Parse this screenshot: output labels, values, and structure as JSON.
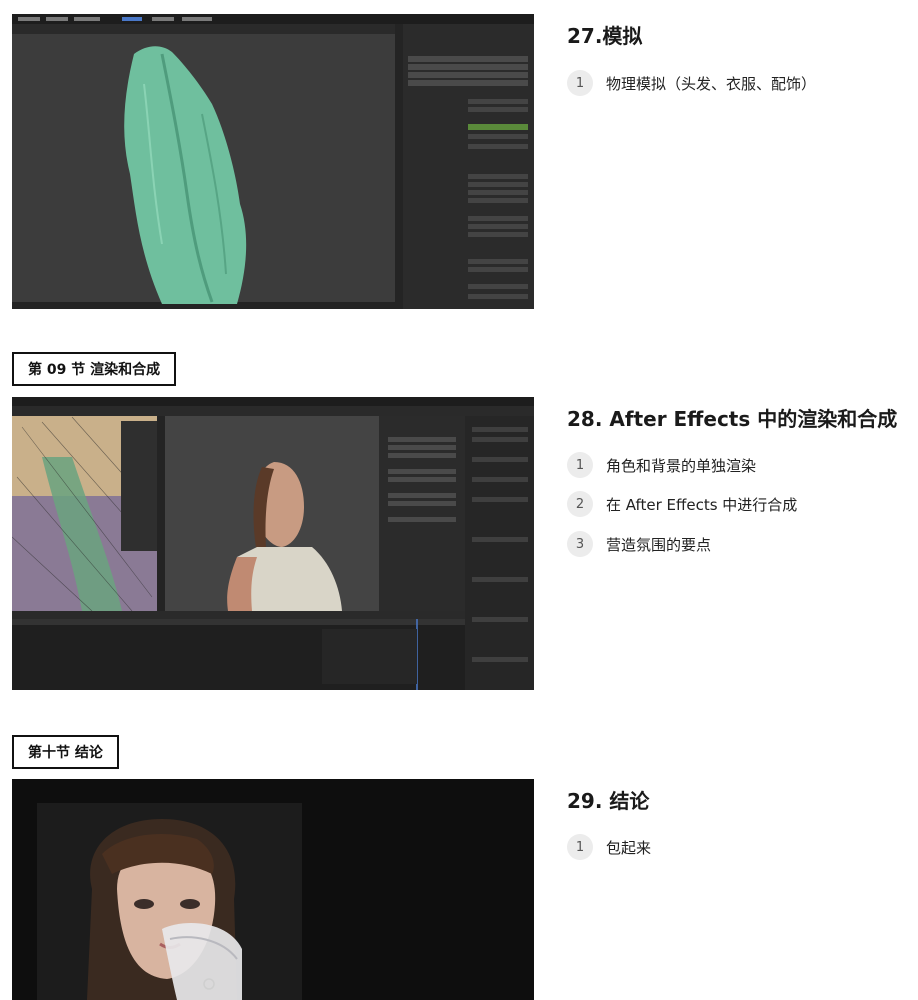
{
  "sections": [
    {
      "heading": "27.模拟",
      "items": [
        {
          "num": "1",
          "text": "物理模拟（头发、衣服、配饰）"
        }
      ]
    },
    {
      "label": "第 09 节 渲染和合成",
      "heading": "28. After Effects 中的渲染和合成",
      "items": [
        {
          "num": "1",
          "text": "角色和背景的单独渲染"
        },
        {
          "num": "2",
          "text": "在 After Effects 中进行合成"
        },
        {
          "num": "3",
          "text": "营造氛围的要点"
        }
      ]
    },
    {
      "label": "第十节 结论",
      "heading": "29. 结论",
      "items": [
        {
          "num": "1",
          "text": "包起来"
        }
      ]
    }
  ],
  "colors": {
    "cloth": "#6fbf9e",
    "blender_bg": "#3a3a3a",
    "blender_panel": "#2b2b2b",
    "timeline_bg": "#1f1f1f",
    "render_bg": "#0e0e0e"
  }
}
